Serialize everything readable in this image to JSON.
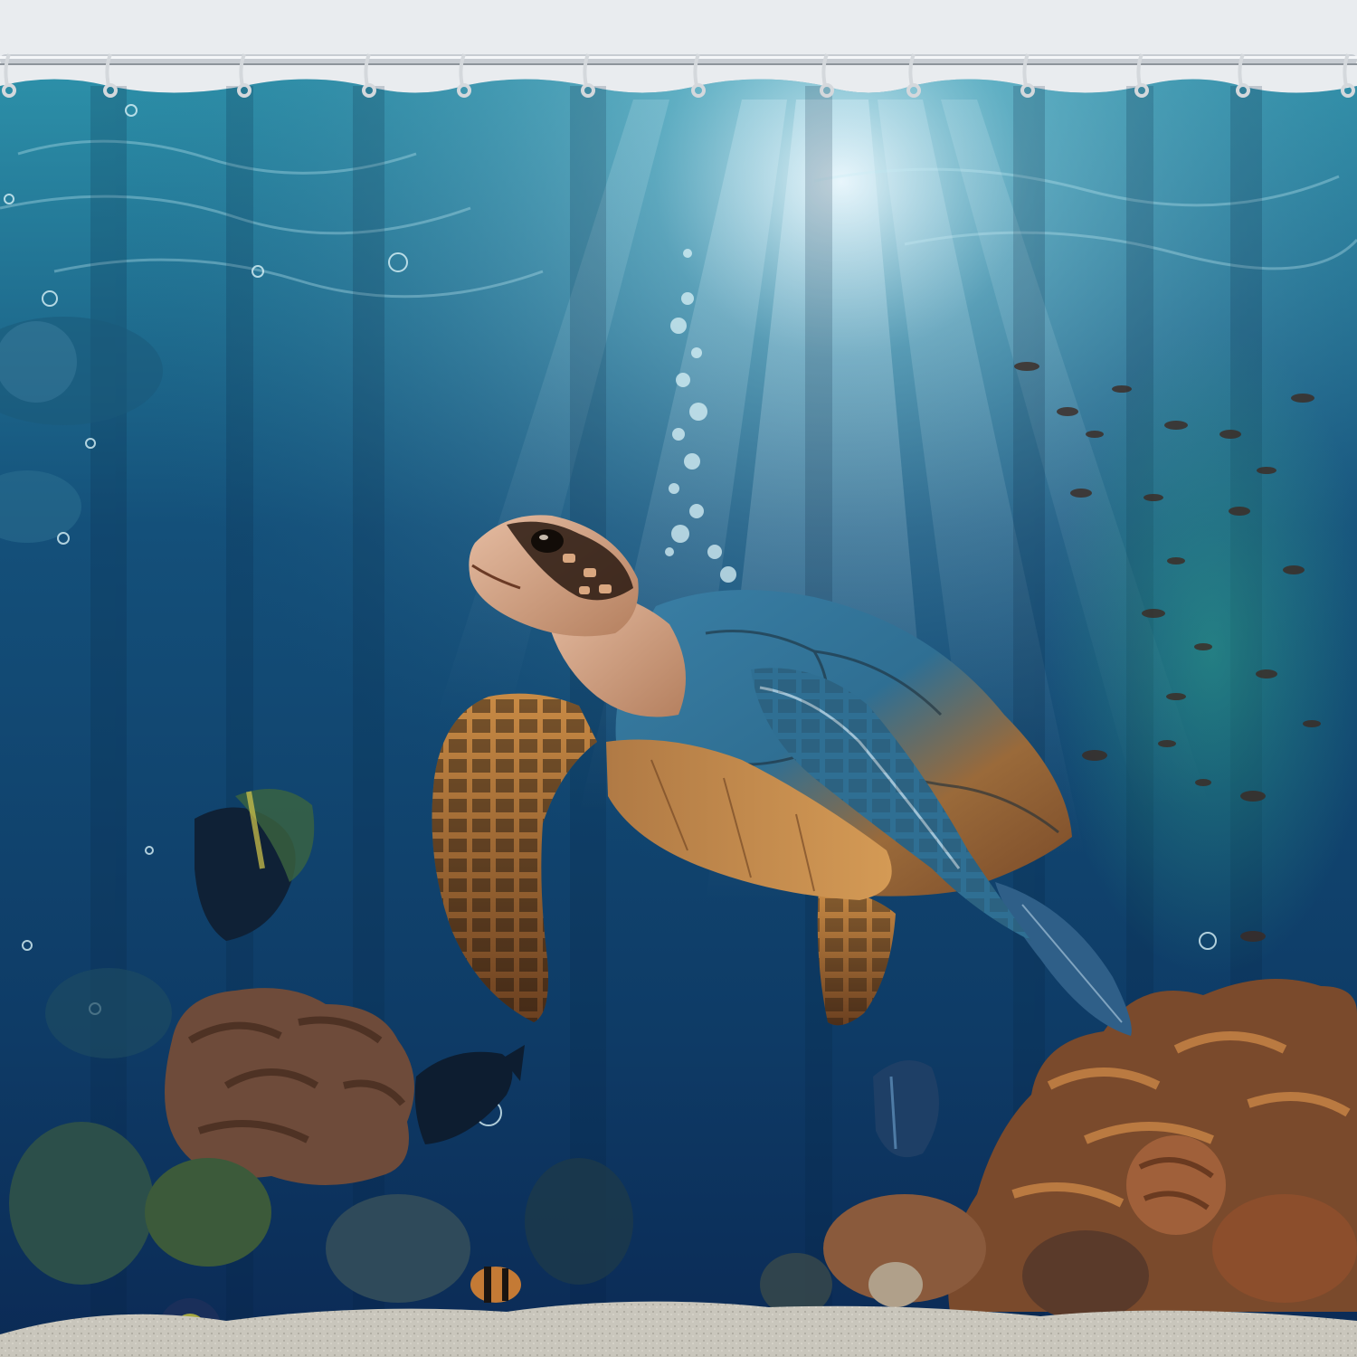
{
  "scene": {
    "subject": "sea-turtle",
    "setting": "underwater-coral-reef",
    "object": "shower-curtain",
    "hook_count": 13,
    "colors": {
      "wall": "#e9ecef",
      "deep_water": "#0b2a55",
      "mid_water": "#14507a",
      "light_water": "#2c8fa8",
      "sun": "#f2fbff",
      "shell_blue": "#2f6f93",
      "shell_amber": "#c9873a",
      "skin": "#d8a98d",
      "coral_brown": "#8a5a3c",
      "coral_orange": "#b8733a",
      "sand": "#c9c6bc",
      "rod": "#c7ccd2"
    }
  }
}
